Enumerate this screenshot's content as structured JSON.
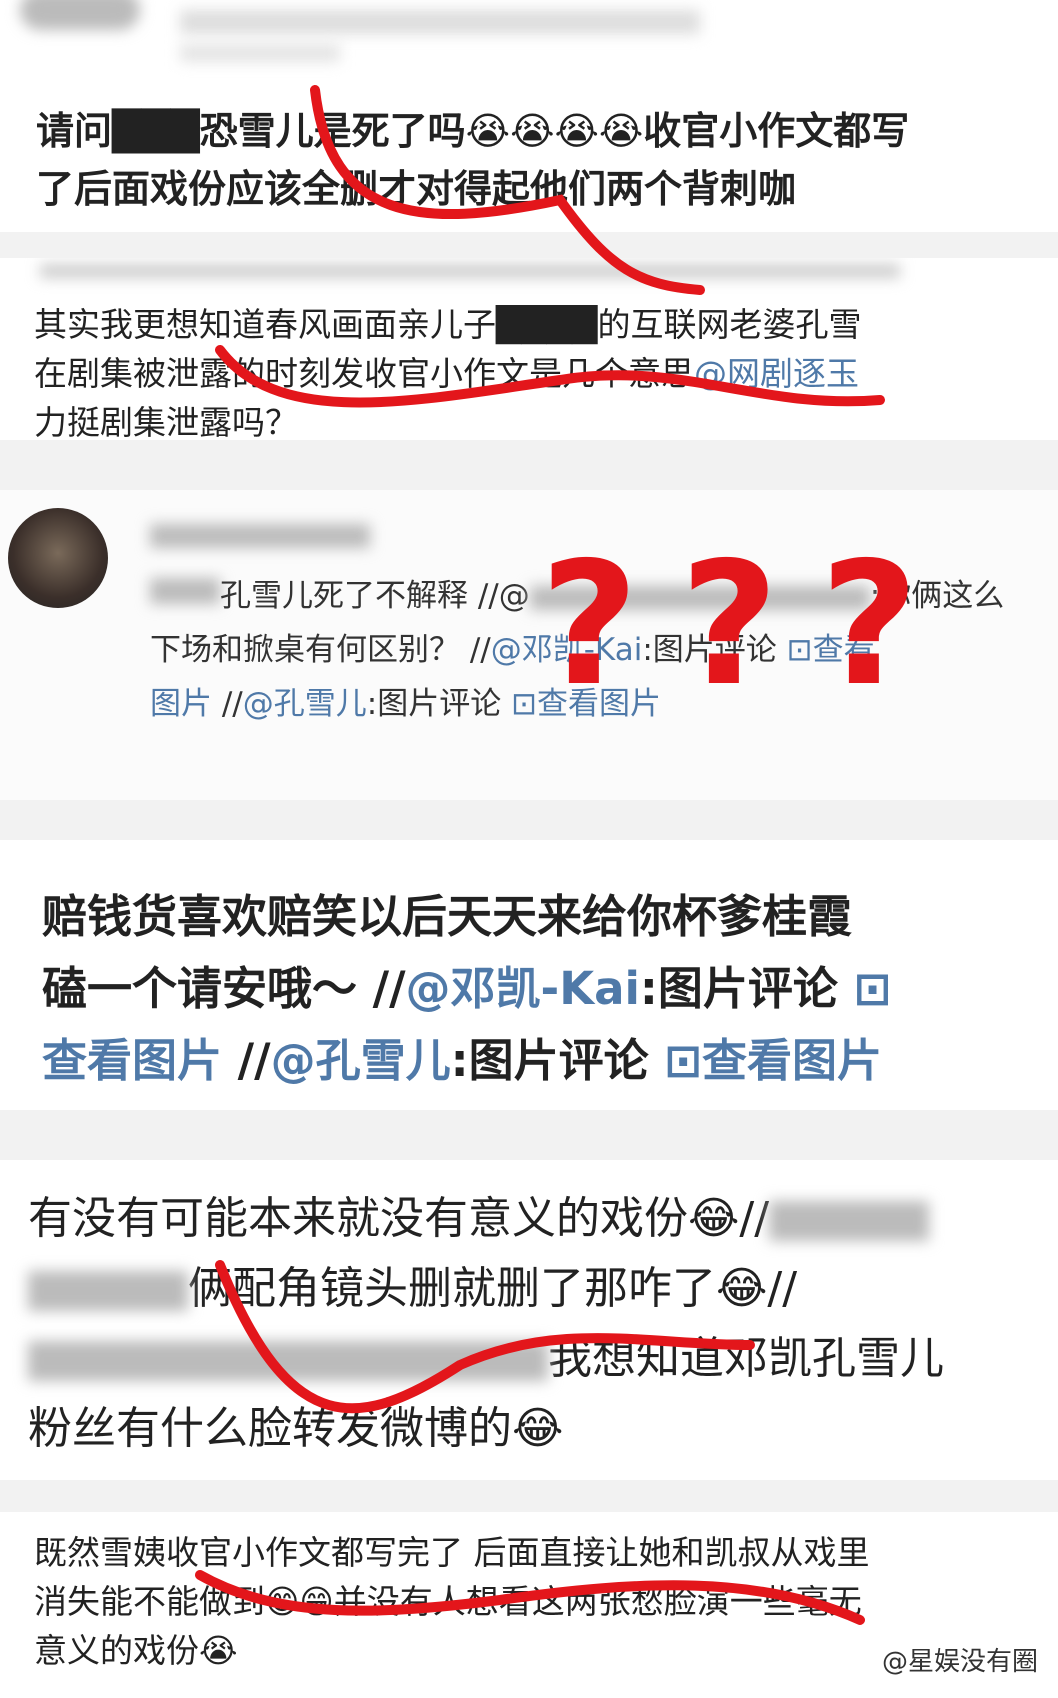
{
  "posts": [
    {
      "lines": [
        "请问███恐雪儿是死了吗😭😭😭😭收官小作文都写",
        "了后面戏份应该全删才对得起他们两个背刺咖"
      ]
    },
    {
      "lines": [
        "其实我更想知道春风画面亲儿子████的互联网老婆孔雪",
        "在剧集被泄露的时刻发收官小作文是几个意思",
        "力挺剧集泄露吗？"
      ],
      "mention": "@网剧逐玉"
    },
    {
      "line1_prefix": "孔雪儿死了不解释 //@",
      "line1_suffix": ":你俩这么",
      "line2": "下场和掀桌有何区别？ //",
      "line2_mention": "@邓凯-Kai",
      "line2_suffix": ":图片评论",
      "line2_view": "查看",
      "line3_view": "图片",
      "line3_sep": " //",
      "line3_mention": "@孔雪儿",
      "line3_suffix": ":图片评论",
      "line3_view2": "查看图片",
      "question_marks": [
        "?",
        "?",
        "?"
      ]
    },
    {
      "line1": "赔钱货喜欢赔笑以后天天来给你杯爹桂霞",
      "line2_prefix": "磕一个请安哦～ //",
      "line2_mention": "@邓凯-Kai",
      "line2_suffix": ":图片评论",
      "line3_view": "查看图片",
      "line3_sep": " //",
      "line3_mention": "@孔雪儿",
      "line3_suffix": ":图片评论",
      "line3_view2": "查看图片"
    },
    {
      "line1": "有没有可能本来就没有意义的戏份😂//",
      "line2": "俩配角镜头删就删了那咋了😂//",
      "line3": "我想知道邓凯孔雪儿",
      "line4": "粉丝有什么脸转发微博的😂"
    },
    {
      "lines": [
        "既然雪姨收官小作文都写完了 后面直接让她和凯叔从戏里",
        "消失能不能做到😁😁并没有人想看这两张愁脸演一些毫无",
        "意义的戏份😭"
      ]
    }
  ],
  "watermark": "@星娱没有圈",
  "colors": {
    "link": "#4f79a8",
    "annotation": "#e3161b",
    "card": "#ffffff",
    "gap": "#eeeeee"
  }
}
